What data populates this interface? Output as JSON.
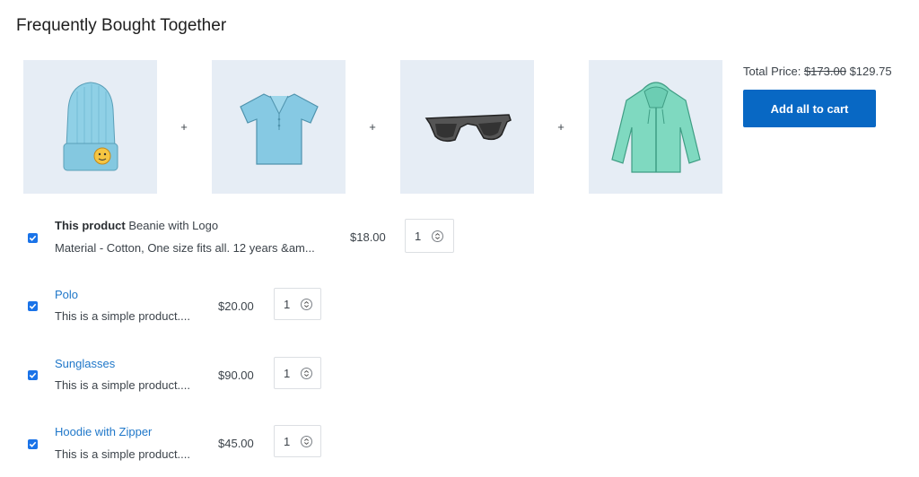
{
  "section": {
    "title": "Frequently Bought Together"
  },
  "summary": {
    "total_label": "Total Price:",
    "original_total": "$173.00",
    "discounted_total": "$129.75",
    "add_all_label": "Add all to cart"
  },
  "images": [
    {
      "icon": "beanie-image",
      "alt": "Beanie with Logo"
    },
    {
      "icon": "polo-image",
      "alt": "Polo"
    },
    {
      "icon": "sunglasses-image",
      "alt": "Sunglasses"
    },
    {
      "icon": "hoodie-image",
      "alt": "Hoodie with Zipper"
    }
  ],
  "plus_sign": "+",
  "products": [
    {
      "prefix": "This product",
      "name": "Beanie with Logo",
      "description": "Material - Cotton, One size fits all. 12 years &am...",
      "price": "$18.00",
      "quantity": "1",
      "checked": true
    },
    {
      "prefix": "",
      "name": "Polo",
      "description": "This is a simple product....",
      "price": "$20.00",
      "quantity": "1",
      "checked": true
    },
    {
      "prefix": "",
      "name": "Sunglasses",
      "description": "This is a simple product....",
      "price": "$90.00",
      "quantity": "1",
      "checked": true
    },
    {
      "prefix": "",
      "name": "Hoodie with Zipper",
      "description": "This is a simple product....",
      "price": "$45.00",
      "quantity": "1",
      "checked": true
    }
  ],
  "colors": {
    "accent": "#0868c4",
    "link": "#1f77c9",
    "tile_bg": "#e6edf5"
  }
}
